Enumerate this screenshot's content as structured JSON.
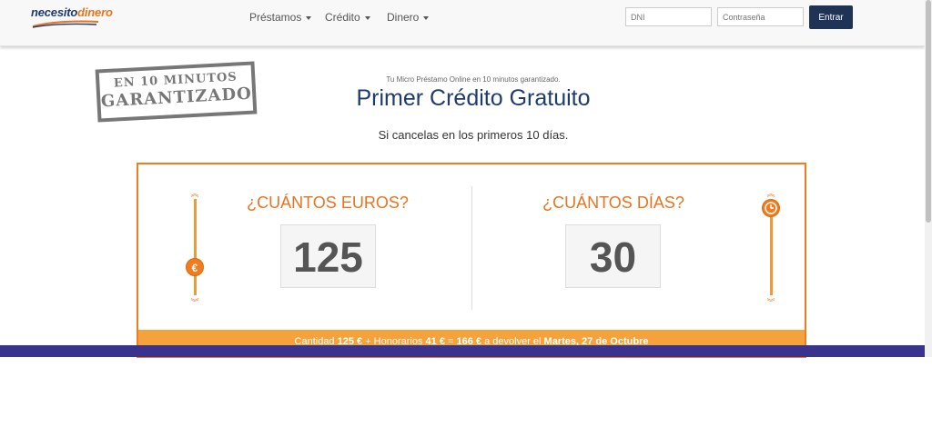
{
  "brand": {
    "logo_part1": "necesito",
    "logo_part2": "dinero"
  },
  "nav": {
    "items": [
      "Préstamos",
      "Crédito",
      "Dinero"
    ]
  },
  "login": {
    "dni_placeholder": "DNI",
    "password_placeholder": "Contraseña",
    "submit_label": "Entrar"
  },
  "stamp": {
    "line1": "EN 10 MINUTOS",
    "line2": "GARANTIZADO"
  },
  "hero": {
    "tagline": "Tu Micro Préstamo Online en 10 minutos garantizado.",
    "headline": "Primer Crédito Gratuito",
    "subline": "Si cancelas en los primeros 10 días."
  },
  "calculator": {
    "euros_title": "¿CUÁNTOS EUROS?",
    "euros_value": "125",
    "days_title": "¿CUÁNTOS DÍAS?",
    "days_value": "30",
    "euro_icon": "€",
    "summary": {
      "t1": "Cantidad ",
      "amount": "125 €",
      "t2": " + Honorarios ",
      "fee": "41 €",
      "t3": " = ",
      "total": "166 €",
      "t4": " a devolver el ",
      "date": "Martes, 27 de Octubre"
    }
  },
  "colors": {
    "accent": "#ef7d1f",
    "navy": "#1e3b6f",
    "summary_bg": "#f6a23c",
    "bottom_bar": "#3a338d"
  }
}
